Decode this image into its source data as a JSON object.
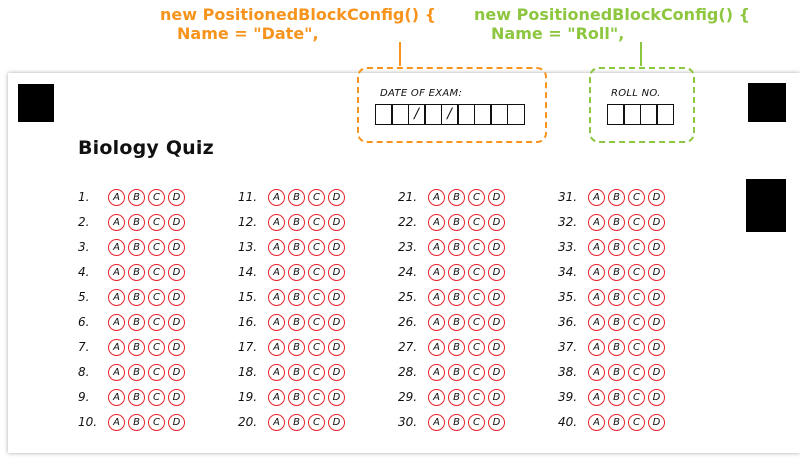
{
  "annotations": {
    "date": {
      "line1": "new PositionedBlockConfig() {",
      "line2": "Name = \"Date\",",
      "color": "#f7941d"
    },
    "roll": {
      "line1": "new PositionedBlockConfig() {",
      "line2": "Name = \"Roll\",",
      "color": "#8dc63f"
    }
  },
  "sheet": {
    "title": "Biology Quiz",
    "date_field": {
      "label": "DATE OF EXAM:",
      "cells": [
        "",
        "",
        "/",
        "",
        "/",
        "",
        "",
        "",
        ""
      ]
    },
    "roll_field": {
      "label": "ROLL NO.",
      "cells": [
        "",
        "",
        "",
        ""
      ]
    },
    "options": [
      "A",
      "B",
      "C",
      "D"
    ],
    "bubble_color": "#e8232a",
    "columns": [
      [
        "1.",
        "2.",
        "3.",
        "4.",
        "5.",
        "6.",
        "7.",
        "8.",
        "9.",
        "10."
      ],
      [
        "11.",
        "12.",
        "13.",
        "14.",
        "15.",
        "16.",
        "17.",
        "18.",
        "19.",
        "20."
      ],
      [
        "21.",
        "22.",
        "23.",
        "24.",
        "25.",
        "26.",
        "27.",
        "28.",
        "29.",
        "30."
      ],
      [
        "31.",
        "32.",
        "33.",
        "34.",
        "35.",
        "36.",
        "37.",
        "38.",
        "39.",
        "40."
      ]
    ]
  }
}
